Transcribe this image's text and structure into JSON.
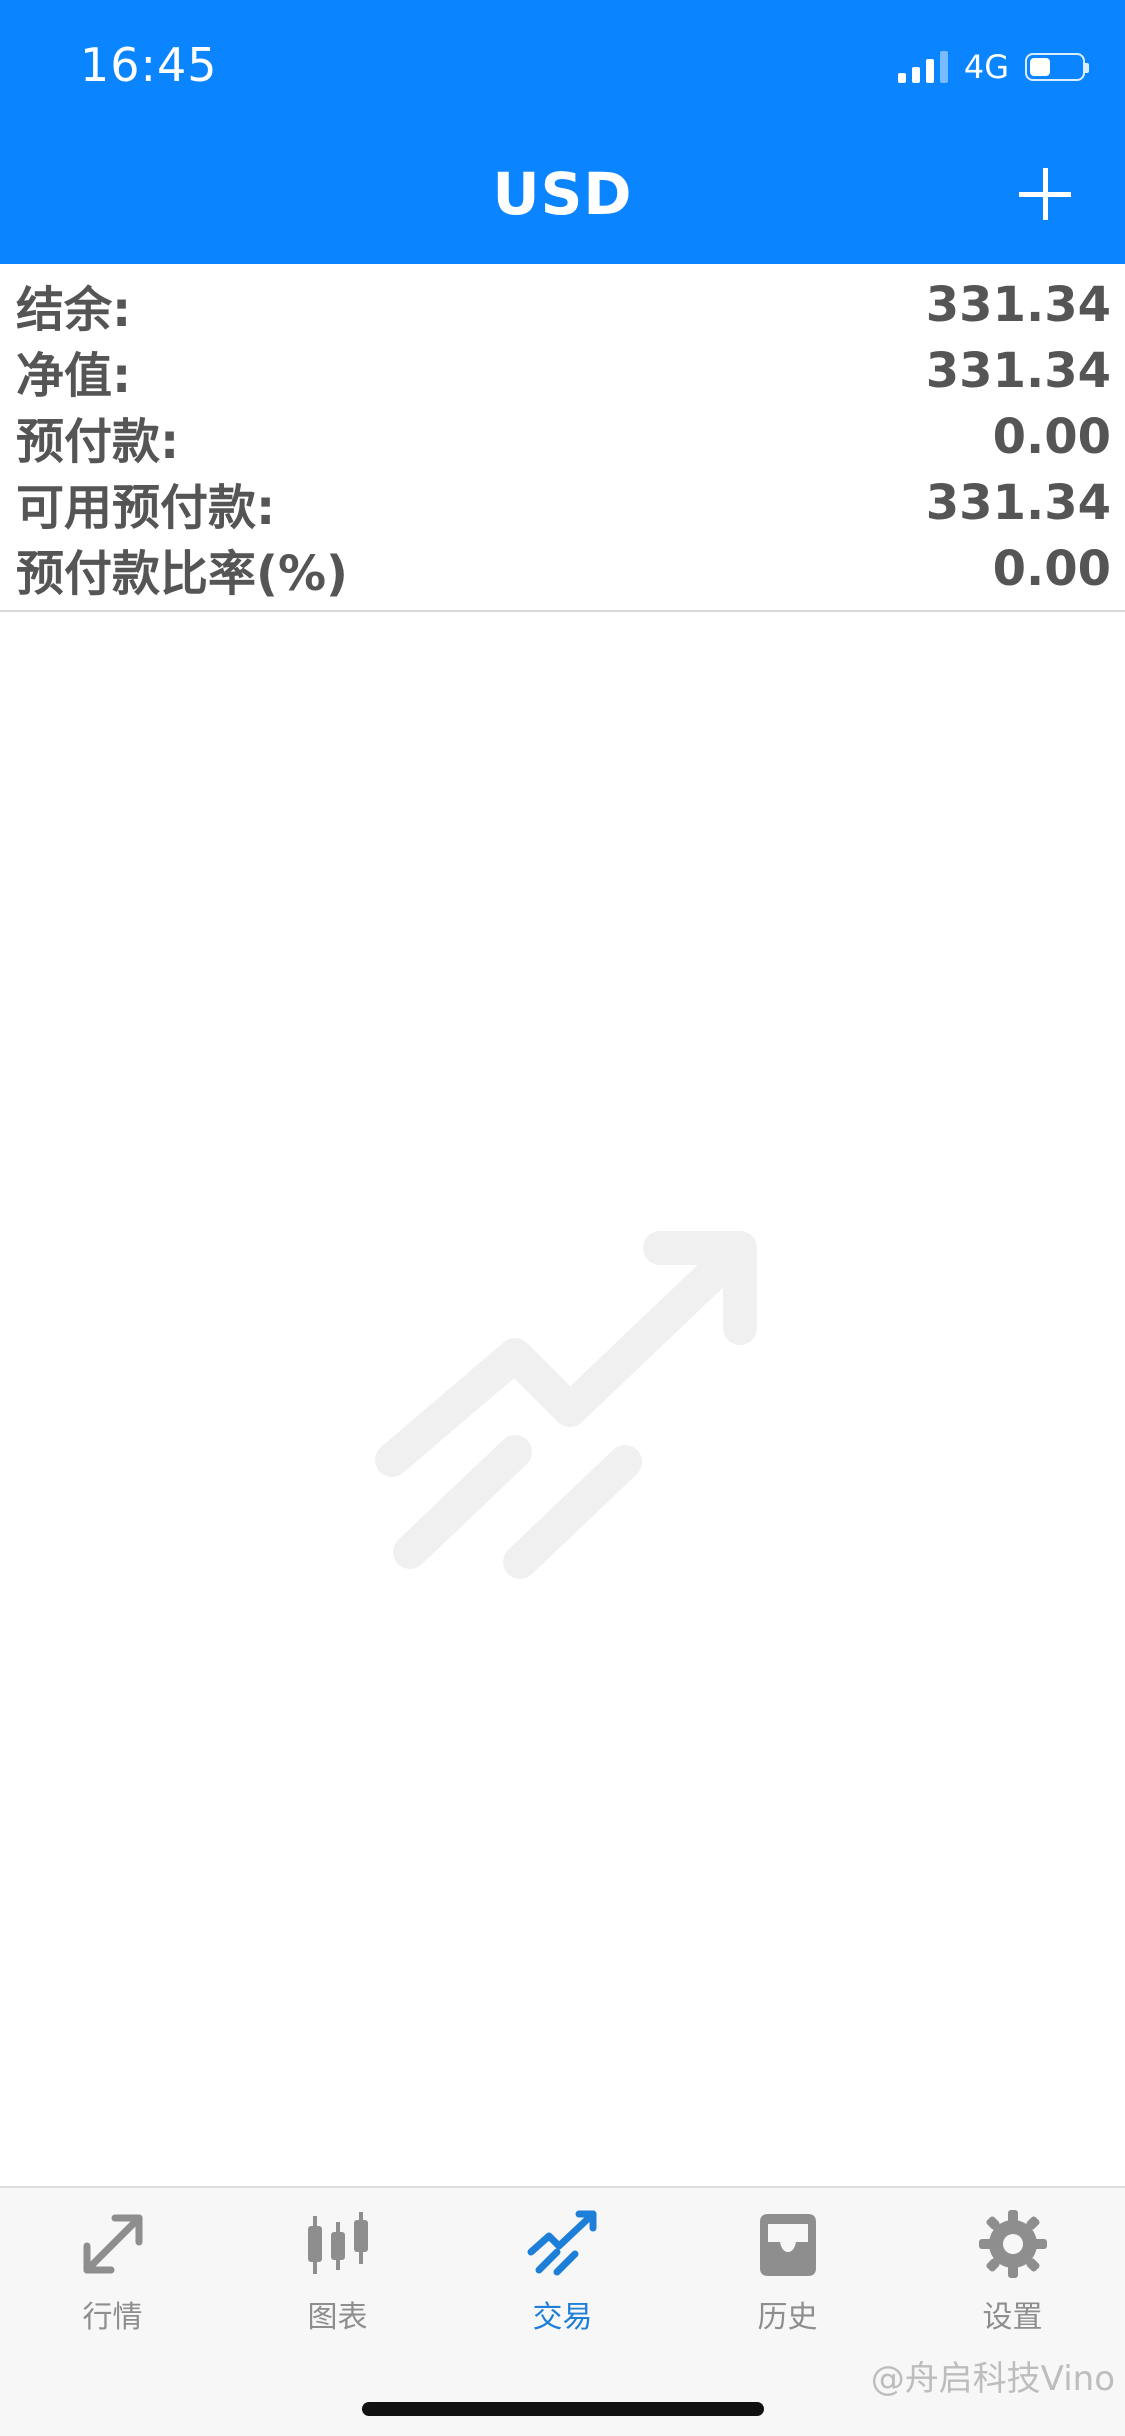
{
  "status_bar": {
    "time": "16:45",
    "network": "4G"
  },
  "header": {
    "title": "USD",
    "add_icon": "plus-icon",
    "background_color": "#0a84ff"
  },
  "summary": [
    {
      "label": "结余:",
      "value": "331.34"
    },
    {
      "label": "净值:",
      "value": "331.34"
    },
    {
      "label": "预付款:",
      "value": "0.00"
    },
    {
      "label": "可用预付款:",
      "value": "331.34"
    },
    {
      "label": "预付款比率(%)",
      "value": "0.00"
    }
  ],
  "empty_state": {
    "icon": "trade-trend-icon"
  },
  "tabbar": {
    "tabs": [
      {
        "label": "行情",
        "icon": "quotes-icon",
        "active": false
      },
      {
        "label": "图表",
        "icon": "chart-candles-icon",
        "active": false
      },
      {
        "label": "交易",
        "icon": "trade-icon",
        "active": true
      },
      {
        "label": "历史",
        "icon": "history-inbox-icon",
        "active": false
      },
      {
        "label": "设置",
        "icon": "settings-gear-icon",
        "active": false
      }
    ],
    "active_color": "#1e7fd9",
    "inactive_color": "#8e8e8e"
  },
  "watermark": "@舟启科技Vino"
}
